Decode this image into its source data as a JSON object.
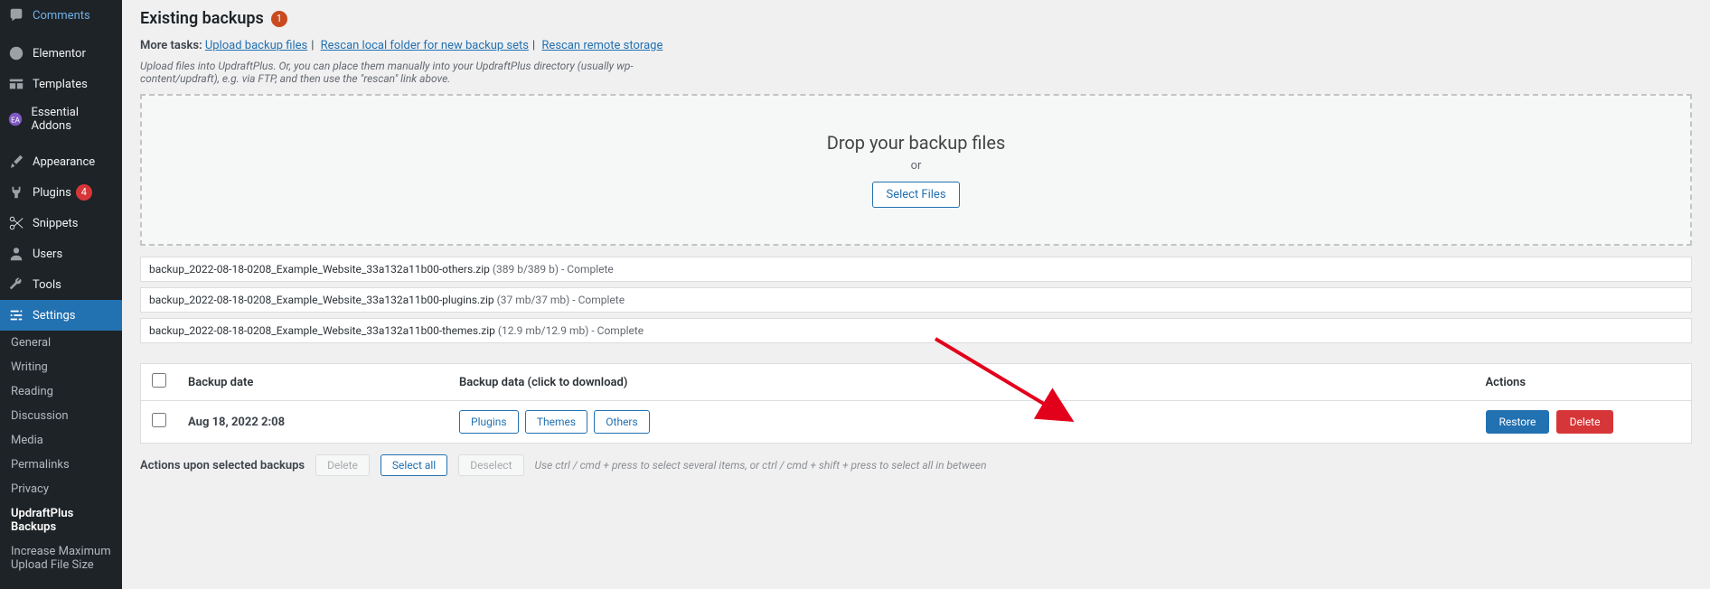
{
  "sidebar": {
    "items": [
      {
        "label": "Comments",
        "icon": "comments"
      },
      {
        "label": "Elementor",
        "icon": "elementor"
      },
      {
        "label": "Templates",
        "icon": "templates"
      },
      {
        "label": "Essential Addons",
        "icon": "essential"
      },
      {
        "label": "Appearance",
        "icon": "brush"
      },
      {
        "label": "Plugins",
        "icon": "plug",
        "count": "4"
      },
      {
        "label": "Snippets",
        "icon": "scissors"
      },
      {
        "label": "Users",
        "icon": "user"
      },
      {
        "label": "Tools",
        "icon": "wrench"
      },
      {
        "label": "Settings",
        "icon": "sliders",
        "active": true
      }
    ],
    "subs": [
      "General",
      "Writing",
      "Reading",
      "Discussion",
      "Media",
      "Permalinks",
      "Privacy",
      "UpdraftPlus Backups",
      "Increase Maximum Upload File Size"
    ],
    "currentSub": 7
  },
  "heading": "Existing backups",
  "headingBadge": "1",
  "tasks": {
    "label": "More tasks:",
    "links": [
      "Upload backup files",
      "Rescan local folder for new backup sets",
      "Rescan remote storage"
    ]
  },
  "helpText": "Upload files into UpdraftPlus. Or, you can place them manually into your UpdraftPlus directory (usually wp-content/updraft), e.g. via FTP, and then use the \"rescan\" link above.",
  "dropzone": {
    "title": "Drop your backup files",
    "or": "or",
    "button": "Select Files"
  },
  "files": [
    {
      "name": "backup_2022-08-18-0208_Example_Website_33a132a11b00-others.zip",
      "meta": "(389 b/389 b) - Complete"
    },
    {
      "name": "backup_2022-08-18-0208_Example_Website_33a132a11b00-plugins.zip",
      "meta": "(37 mb/37 mb) - Complete"
    },
    {
      "name": "backup_2022-08-18-0208_Example_Website_33a132a11b00-themes.zip",
      "meta": "(12.9 mb/12.9 mb) - Complete"
    }
  ],
  "table": {
    "headers": {
      "date": "Backup date",
      "data": "Backup data (click to download)",
      "actions": "Actions"
    },
    "rows": [
      {
        "date": "Aug 18, 2022 2:08",
        "dataBtns": [
          "Plugins",
          "Themes",
          "Others"
        ],
        "restore": "Restore",
        "del": "Delete"
      }
    ]
  },
  "actionsBar": {
    "label": "Actions upon selected backups",
    "delete": "Delete",
    "selectAll": "Select all",
    "deselect": "Deselect",
    "hint": "Use ctrl / cmd + press to select several items, or ctrl / cmd + shift + press to select all in between"
  }
}
